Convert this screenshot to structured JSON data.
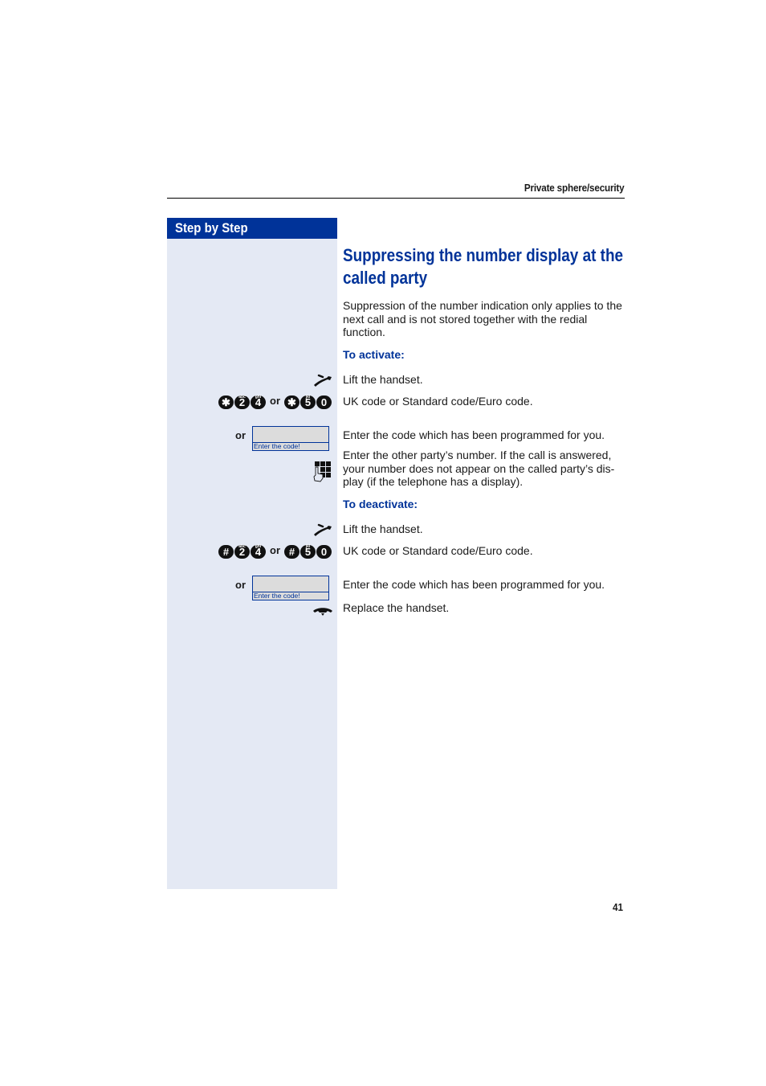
{
  "header": {
    "section_title": "Private sphere/security"
  },
  "sidebar": {
    "heading": "Step by Step"
  },
  "main": {
    "title_line1": "Suppressing the number display at the",
    "title_line2": "called party",
    "intro": "Suppression of the number indication only applies to the next call and is not stored together with the redial function.",
    "activate": {
      "heading": "To activate:",
      "steps": [
        {
          "icon": "lift-handset-icon",
          "text": "Lift the handset."
        },
        {
          "icon": "keys",
          "text": "UK code or Standard code/Euro code."
        },
        {
          "icon": "display",
          "text": "Enter the code which has been programmed for you."
        },
        {
          "icon": "keypad-icon",
          "text": "Enter the other party’s number. If the call is answered, your number does not appear on the called party’s dis-play (if the telephone has a display)."
        }
      ]
    },
    "deactivate": {
      "heading": "To deactivate:",
      "steps": [
        {
          "icon": "lift-handset-icon",
          "text": "Lift the handset."
        },
        {
          "icon": "keys",
          "text": "UK code or Standard code/Euro code."
        },
        {
          "icon": "display",
          "text": "Enter the code which has been programmed for you."
        },
        {
          "icon": "replace-handset-icon",
          "text": "Replace the handset."
        }
      ]
    }
  },
  "codes": {
    "activate_uk": [
      {
        "main": "✱",
        "sub": ""
      },
      {
        "main": "2",
        "sub": "abc"
      },
      {
        "main": "4",
        "sub": "ghi"
      }
    ],
    "activate_euro": [
      {
        "main": "✱",
        "sub": ""
      },
      {
        "main": "5",
        "sub": "jkl"
      },
      {
        "main": "0",
        "sub": ""
      }
    ],
    "deactivate_uk": [
      {
        "main": "#",
        "sub": ""
      },
      {
        "main": "2",
        "sub": "abc"
      },
      {
        "main": "4",
        "sub": "ghi"
      }
    ],
    "deactivate_euro": [
      {
        "main": "#",
        "sub": ""
      },
      {
        "main": "5",
        "sub": "jkl"
      },
      {
        "main": "0",
        "sub": ""
      }
    ],
    "or_label": "or"
  },
  "display": {
    "or_label": "or",
    "prompt": "Enter the code!"
  },
  "footer": {
    "page_number": "41"
  },
  "colors": {
    "brand_blue": "#003399",
    "sidebar_bg": "#e4e9f4",
    "display_bg": "#dcdcdc"
  }
}
